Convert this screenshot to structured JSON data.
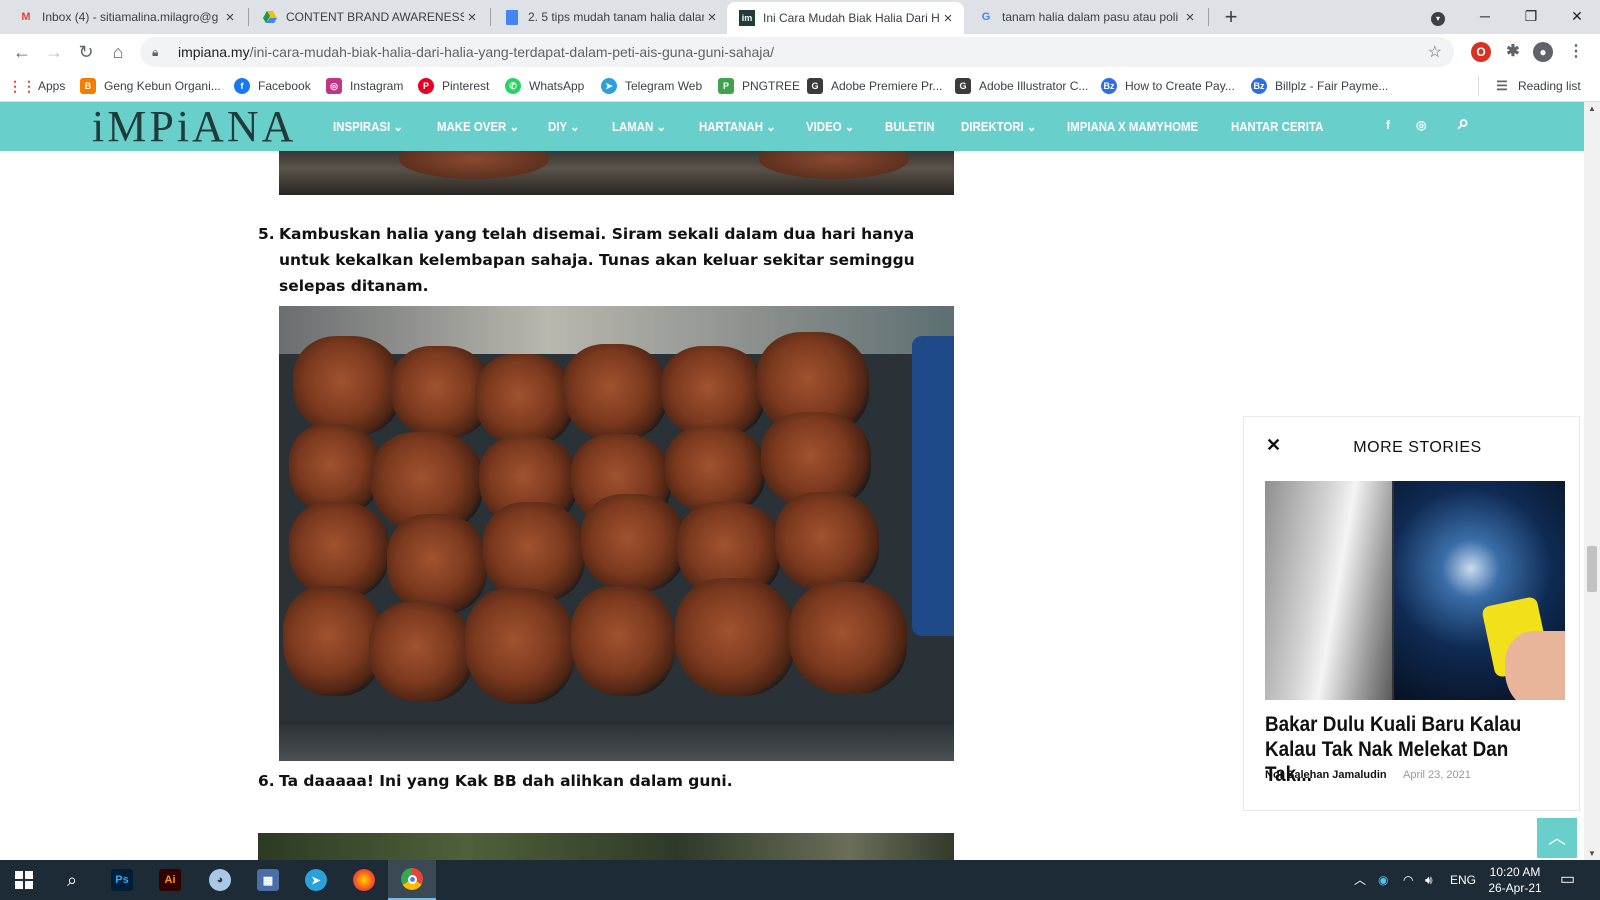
{
  "tabs": [
    {
      "title": "Inbox (4) - sitiamalina.milagro@g",
      "favicon": "gmail-icon",
      "active": false
    },
    {
      "title": "CONTENT BRAND AWARENESS -",
      "favicon": "google-drive-icon",
      "active": false
    },
    {
      "title": "2. 5 tips mudah tanam halia dalam",
      "favicon": "google-docs-icon",
      "active": false
    },
    {
      "title": "Ini Cara Mudah Biak Halia Dari H",
      "favicon": "impiana-icon",
      "active": true
    },
    {
      "title": "tanam halia dalam pasu atau poli",
      "favicon": "google-icon",
      "active": false
    }
  ],
  "address": {
    "host": "impiana.my",
    "path": "/ini-cara-mudah-biak-halia-dari-halia-yang-terdapat-dalam-peti-ais-guna-guni-sahaja/"
  },
  "bookmarks": [
    {
      "label": "Apps",
      "icon": "apps-grid-icon",
      "color": "#ea4335"
    },
    {
      "label": "Geng Kebun Organi...",
      "icon": "blogger-icon",
      "color": "#f57d00"
    },
    {
      "label": "Facebook",
      "icon": "facebook-icon",
      "color": "#1877f2"
    },
    {
      "label": "Instagram",
      "icon": "instagram-icon",
      "color": "#c13584"
    },
    {
      "label": "Pinterest",
      "icon": "pinterest-icon",
      "color": "#e60023"
    },
    {
      "label": "WhatsApp",
      "icon": "whatsapp-icon",
      "color": "#25d366"
    },
    {
      "label": "Telegram Web",
      "icon": "telegram-icon",
      "color": "#2aa1da"
    },
    {
      "label": "PNGTREE",
      "icon": "pngtree-icon",
      "color": "#3fa34d"
    },
    {
      "label": "Adobe Premiere Pr...",
      "icon": "g-icon",
      "color": "#3b3b3b"
    },
    {
      "label": "Adobe Illustrator C...",
      "icon": "g-icon",
      "color": "#3b3b3b"
    },
    {
      "label": "How to Create Pay...",
      "icon": "billplz-icon",
      "color": "#2e6de8"
    },
    {
      "label": "Billplz - Fair Payme...",
      "icon": "billplz-icon",
      "color": "#2e6de8"
    }
  ],
  "reading_list": "Reading list",
  "site": {
    "logo": "iMPiANA",
    "menu": [
      {
        "label": "INSPIRASI",
        "dropdown": true
      },
      {
        "label": "MAKE OVER",
        "dropdown": true
      },
      {
        "label": "DIY",
        "dropdown": true
      },
      {
        "label": "LAMAN",
        "dropdown": true
      },
      {
        "label": "HARTANAH",
        "dropdown": true
      },
      {
        "label": "VIDEO",
        "dropdown": true
      },
      {
        "label": "BULETIN",
        "dropdown": false
      },
      {
        "label": "DIREKTORI",
        "dropdown": true
      },
      {
        "label": "IMPIANA X MAMYHOME",
        "dropdown": false
      },
      {
        "label": "HANTAR CERITA",
        "dropdown": false
      }
    ],
    "accent": "#69cfcb"
  },
  "article": {
    "step5_num": "5.",
    "step5_text": "Kambuskan halia yang telah disemai. Siram sekali dalam dua hari hanya untuk kekalkan kelembapan sahaja. Tunas akan keluar sekitar seminggu selepas ditanam.",
    "step6_num": "6.",
    "step6_text": "Ta daaaaa! Ini yang Kak BB dah alihkan dalam guni."
  },
  "more_stories": {
    "heading": "MORE STORIES",
    "headline": "Bakar Dulu Kuali Baru Kalau Kalau Tak Nak Melekat Dan Tak...",
    "author": "Nor Salehan Jamaludin",
    "date": "April 23, 2021"
  },
  "taskbar": {
    "apps": [
      "windows-start-icon",
      "search-icon",
      "photoshop-icon",
      "illustrator-icon",
      "paint-icon",
      "calculator-icon",
      "telegram-icon",
      "firefox-icon",
      "chrome-icon"
    ],
    "language": "ENG",
    "time": "10:20 AM",
    "date": "26-Apr-21"
  }
}
